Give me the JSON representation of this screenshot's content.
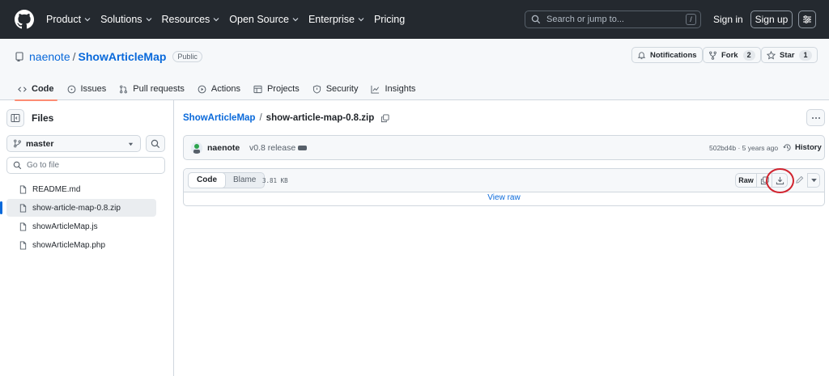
{
  "header": {
    "nav": [
      {
        "label": "Product",
        "has_caret": true
      },
      {
        "label": "Solutions",
        "has_caret": true
      },
      {
        "label": "Resources",
        "has_caret": true
      },
      {
        "label": "Open Source",
        "has_caret": true
      },
      {
        "label": "Enterprise",
        "has_caret": true
      },
      {
        "label": "Pricing",
        "has_caret": false
      }
    ],
    "search_placeholder": "Search or jump to...",
    "search_shortcut": "/",
    "sign_in": "Sign in",
    "sign_up": "Sign up"
  },
  "repo": {
    "owner": "naenote",
    "separator": "/",
    "name": "ShowArticleMap",
    "visibility": "Public",
    "notifications_label": "Notifications",
    "fork_label": "Fork",
    "fork_count": "2",
    "star_label": "Star",
    "star_count": "1",
    "tabs": [
      {
        "label": "Code",
        "icon": "code-icon",
        "active": true
      },
      {
        "label": "Issues",
        "icon": "issue-icon",
        "active": false
      },
      {
        "label": "Pull requests",
        "icon": "pull-request-icon",
        "active": false
      },
      {
        "label": "Actions",
        "icon": "play-icon",
        "active": false
      },
      {
        "label": "Projects",
        "icon": "table-icon",
        "active": false
      },
      {
        "label": "Security",
        "icon": "shield-icon",
        "active": false
      },
      {
        "label": "Insights",
        "icon": "graph-icon",
        "active": false
      }
    ]
  },
  "sidebar": {
    "title": "Files",
    "branch": "master",
    "goto_placeholder": "Go to file",
    "files": [
      {
        "name": "README.md",
        "selected": false
      },
      {
        "name": "show-article-map-0.8.zip",
        "selected": true
      },
      {
        "name": "showArticleMap.js",
        "selected": false
      },
      {
        "name": "showArticleMap.php",
        "selected": false
      }
    ]
  },
  "main": {
    "breadcrumb_repo": "ShowArticleMap",
    "breadcrumb_sep": "/",
    "file_name": "show-article-map-0.8.zip",
    "commit": {
      "author": "naenote",
      "message": "v0.8 release",
      "meta": "502bd4b · 5 years ago",
      "history_label": "History"
    },
    "toolbar": {
      "code_label": "Code",
      "blame_label": "Blame",
      "file_size": "3.81 KB",
      "raw_label": "Raw"
    },
    "view_raw": "View raw"
  },
  "colors": {
    "header_bg": "#24292f",
    "link": "#0969da",
    "active_tab_underline": "#fd8c73",
    "highlight_ring": "#d1242f"
  }
}
